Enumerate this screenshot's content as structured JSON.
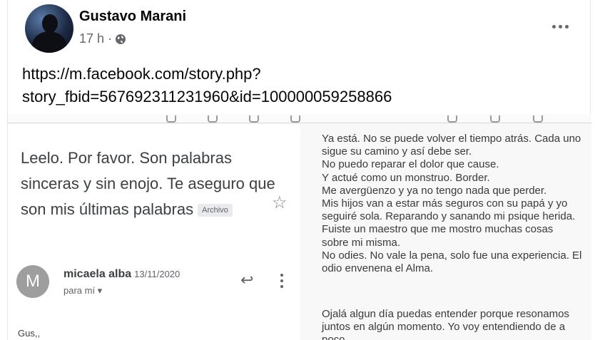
{
  "post": {
    "author": "Gustavo Marani",
    "timestamp": "17 h ·",
    "privacy_icon": "globe-icon",
    "more_icon": "more-options-icon",
    "text": "https://m.facebook.com/story.php?\nstory_fbid=567692311231960&id=100000059258866"
  },
  "email": {
    "subject": "Leelo. Por favor. Son palabras sinceras y sin enojo.  Te aseguro que son mis últimas palabras",
    "label_badge": "Archivo",
    "sender_initial": "M",
    "sender_name": "micaela alba",
    "date": "13/11/2020",
    "recipient": "para mí ▾",
    "body_start": "Gus,,",
    "icons": [
      "star-icon",
      "reply-icon",
      "more-vertical-icon"
    ]
  },
  "letter": {
    "paragraph_1": "Ya está. No se puede volver el tiempo atrás. Cada uno\nsigue su camino y así debe ser.\nNo puedo reparar el dolor que cause.\nY actué como un monstruo. Border.\nMe avergüenzo y ya no tengo nada que perder.\nMis hijos van a estar más seguros con su papá y yo\nseguiré sola. Reparando y sanando mi psique herida.\nFuiste un maestro que me mostro muchas cosas\nsobre mi misma.\nNo odies. No vale la pena, solo fue una experiencia. El\nodio envenena el Alma.",
    "paragraph_2": "Ojalá algun día puedas entender porque resonamos\njuntos en algún momento. Yo voy entendiendo de a\npoco"
  }
}
